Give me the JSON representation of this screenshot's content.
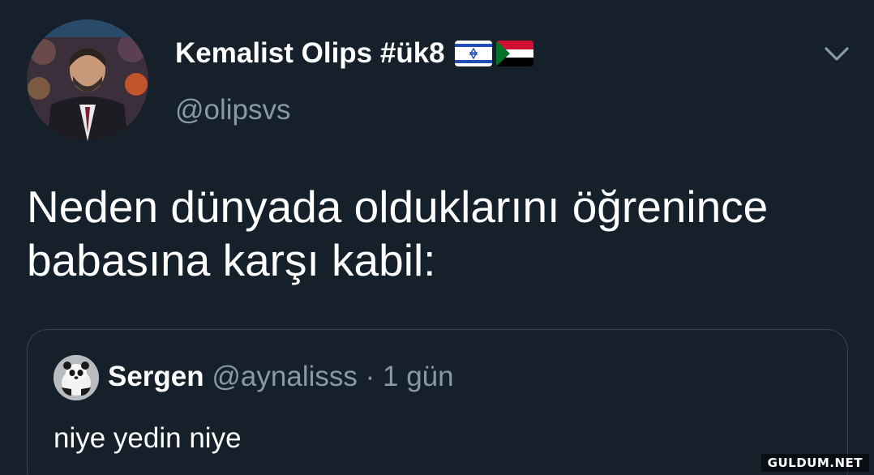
{
  "tweet": {
    "author": {
      "display_name": "Kemalist Olips #ük8",
      "handle": "@olipsvs",
      "flags": [
        "israel-flag",
        "sudan-flag"
      ]
    },
    "text_lines": [
      "Neden dünyada olduklarını öğrenince",
      "babasına karşı kabil:"
    ],
    "menu_icon": "chevron-down-icon"
  },
  "quoted_tweet": {
    "display_name": "Sergen",
    "handle": "@aynalisss",
    "separator": "·",
    "time": "1 gün",
    "text": "niye yedin niye"
  },
  "watermark": "GULDUM.NET",
  "colors": {
    "background": "#15202b",
    "primary_text": "#ffffff",
    "secondary_text": "#8899a6",
    "border": "#38444d"
  }
}
